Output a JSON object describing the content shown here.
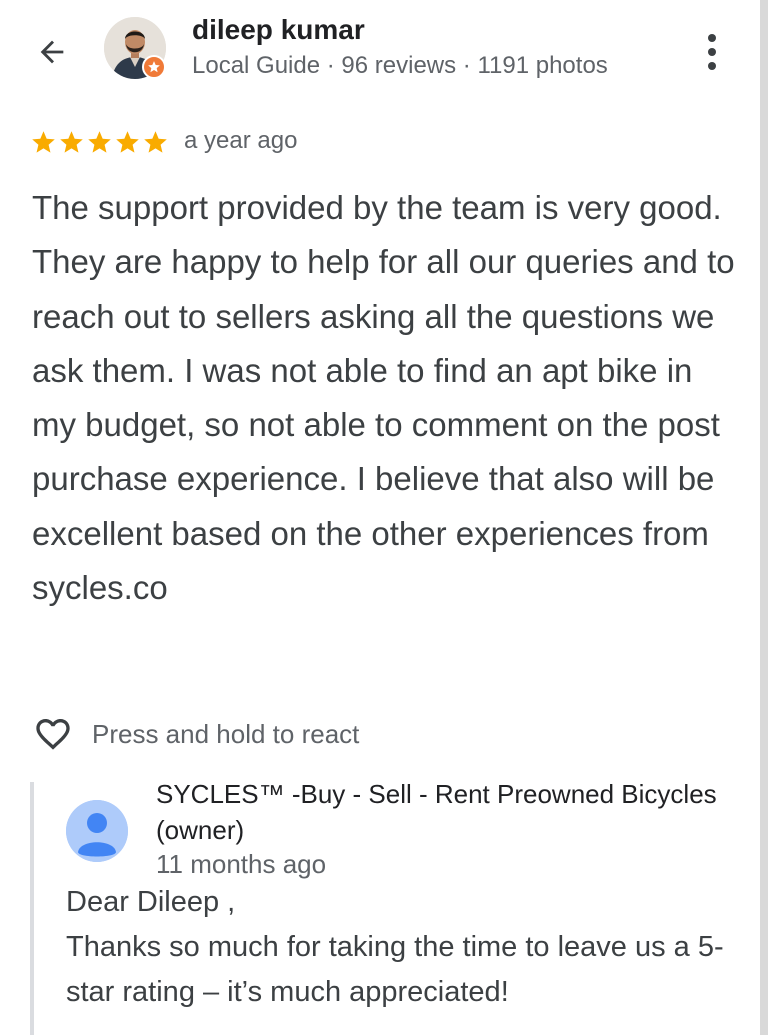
{
  "header": {
    "back_icon": "arrow-back-icon",
    "reviewer_name": "dileep kumar",
    "reviewer_meta": "Local Guide · 96 reviews · 1191 photos",
    "badge_icon": "local-guide-star-icon",
    "more_icon": "more-vert-icon"
  },
  "rating": {
    "stars": 5,
    "max_stars": 5,
    "star_color": "#f9ab00",
    "date": "a year ago"
  },
  "review": {
    "text": "The support provided by the team is very good. They are happy to help for all our queries and to reach out to sellers asking all the questions we ask them. I was not able to find an apt bike in my budget, so not able to comment on the post purchase experience. I believe that also will be excellent based on the other experiences from sycles.co"
  },
  "react": {
    "icon": "heart-outline-icon",
    "label": "Press and hold to react"
  },
  "owner_response": {
    "name": "SYCLES™ -Buy - Sell - Rent Preowned Bicycles (owner)",
    "date": "11 months ago",
    "avatar_icon": "person-icon",
    "avatar_color": "#aecbfa",
    "reply_line_1": "Dear Dileep ,",
    "reply_line_2": "Thanks so much for taking the time to leave us a 5-star rating – it’s much appreciated!"
  }
}
